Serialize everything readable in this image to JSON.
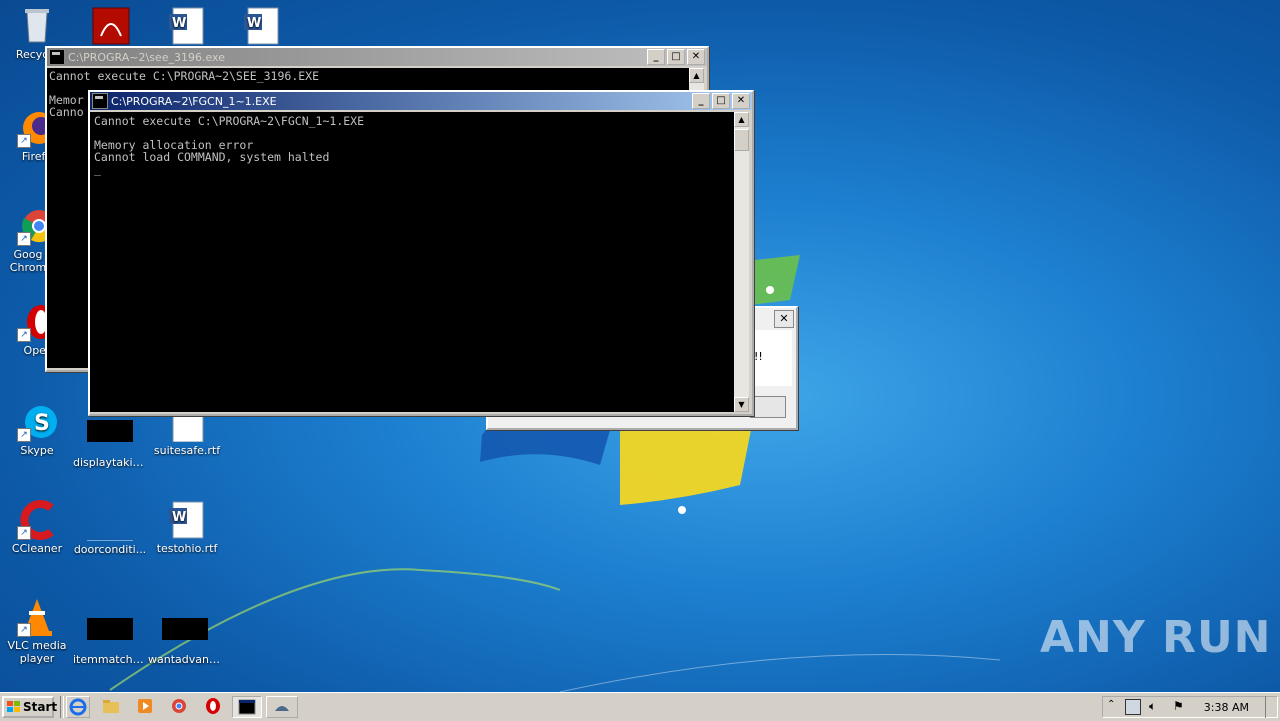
{
  "desktop": {
    "icons": [
      {
        "label": "Recycle"
      },
      {
        "label": "Firefo"
      },
      {
        "label": "Goog Chrom"
      },
      {
        "label": "Oper"
      },
      {
        "label": "Skype"
      },
      {
        "label": "displaytakin..."
      },
      {
        "label": "suitesafe.rtf"
      },
      {
        "label": "CCleaner"
      },
      {
        "label": "doorconditi..."
      },
      {
        "label": "testohio.rtf"
      },
      {
        "label": "VLC media player"
      },
      {
        "label": "itemmatch.jpg"
      },
      {
        "label": "wantadvanc..."
      }
    ]
  },
  "window_back": {
    "title": "C:\\PROGRA~2\\see_3196.exe",
    "console_text": "Cannot execute C:\\PROGRA~2\\SEE_3196.EXE\n\nMemor\nCanno"
  },
  "window_front": {
    "title": "C:\\PROGRA~2\\FGCN_1~1.EXE",
    "console_text": "Cannot execute C:\\PROGRA~2\\FGCN_1~1.EXE\n\nMemory allocation error\nCannot load COMMAND, system halted\n_"
  },
  "dialog_partial": {
    "text_fragment": "!!"
  },
  "taskbar": {
    "start_label": "Start",
    "clock": "3:38 AM"
  },
  "watermark": "ANY RUN",
  "colors": {
    "desktop_blue": "#1d7fd0",
    "active_title": "#0a246a",
    "inactive_title": "#808080",
    "console_bg": "#000000",
    "console_fg": "#c0c0c0"
  }
}
